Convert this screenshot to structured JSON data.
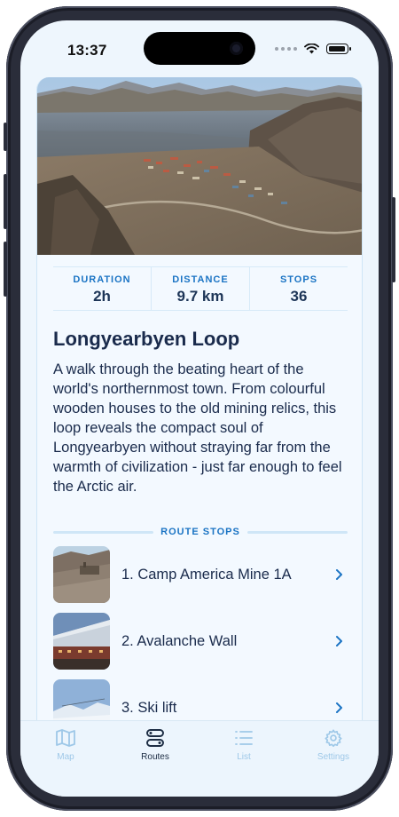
{
  "status_bar": {
    "time": "13:37"
  },
  "route": {
    "title": "Longyearbyen Loop",
    "description": "A walk through the beating heart of the world's northernmost town. From colourful wooden houses to the old mining relics, this loop reveals the compact soul of Longyearbyen without straying far from the warmth of civilization - just far enough to feel the Arctic air.",
    "stats": [
      {
        "label": "DURATION",
        "value": "2h"
      },
      {
        "label": "DISTANCE",
        "value": "9.7 km"
      },
      {
        "label": "STOPS",
        "value": "36"
      }
    ]
  },
  "stops_section": {
    "label": "ROUTE STOPS"
  },
  "stops": [
    {
      "name": "1. Camp America Mine 1A",
      "thumb_icon": "mine-photo"
    },
    {
      "name": "2. Avalanche Wall",
      "thumb_icon": "wall-photo"
    },
    {
      "name": "3. Ski lift",
      "thumb_icon": "ski-lift-photo"
    }
  ],
  "tabbar": {
    "active": "Routes",
    "tabs": [
      {
        "label": "Map",
        "icon": "map-icon"
      },
      {
        "label": "Routes",
        "icon": "routes-icon"
      },
      {
        "label": "List",
        "icon": "list-icon"
      },
      {
        "label": "Settings",
        "icon": "gear-icon"
      }
    ]
  },
  "colors": {
    "accent": "#1b74c4",
    "text": "#1a2b4c",
    "background": "#eef6fd",
    "inactive_tab": "#9ec8e8"
  }
}
